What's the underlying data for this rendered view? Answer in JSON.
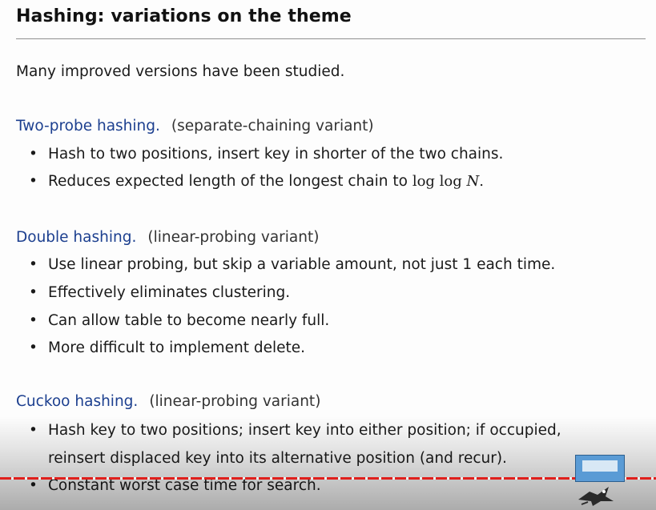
{
  "slide": {
    "title": "Hashing: variations on the theme",
    "intro": "Many improved versions have been studied."
  },
  "sections": [
    {
      "name": "Two-probe hashing.",
      "variant": "(separate-chaining variant)",
      "bullets": [
        "Hash to two positions, insert key in shorter of the two chains.",
        "Reduces expected length of the longest chain to "
      ],
      "math": "log log N",
      "math_prefix": "log log ",
      "math_var": "N",
      "math_suffix": "."
    },
    {
      "name": "Double hashing.",
      "variant": "(linear-probing variant)",
      "bullets": [
        "Use linear probing, but skip a variable amount, not just 1 each time.",
        "Effectively eliminates clustering.",
        "Can allow table to become nearly full.",
        "More difficult to implement delete."
      ]
    },
    {
      "name": "Cuckoo hashing.",
      "variant": "(linear-probing variant)",
      "bullets": [
        "Hash key to two positions; insert key into either position; if occupied,",
        "reinsert displaced key into its alternative position (and recur).",
        "Constant worst case time for search."
      ]
    }
  ],
  "overlay": {
    "progress_color": "#e0201c"
  }
}
